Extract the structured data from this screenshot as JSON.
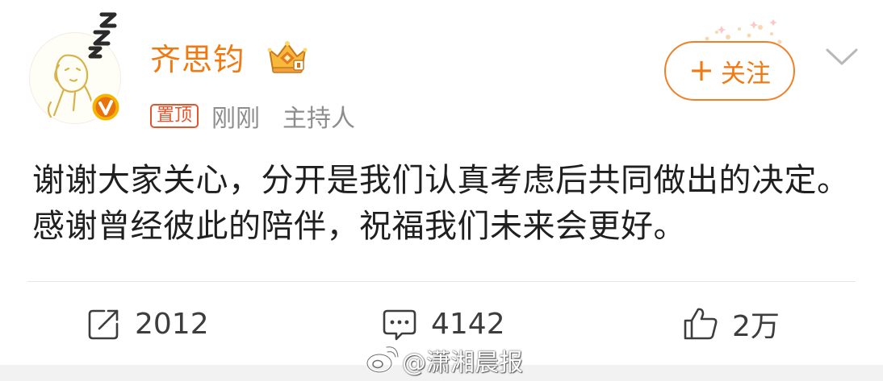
{
  "user": {
    "name": "齐思钧",
    "pin_label": "置顶",
    "time": "刚刚",
    "role": "主持人",
    "follow_label": "关注",
    "follow_plus": "+"
  },
  "post": {
    "text": "谢谢大家关心，分开是我们认真考虑后共同做出的决定。感谢曾经彼此的陪伴，祝福我们未来会更好。"
  },
  "actions": {
    "repost_count": "2012",
    "comment_count": "4142",
    "like_count": "2万"
  },
  "watermark": {
    "text": "@潇湘晨报"
  },
  "colors": {
    "accent": "#f07a11",
    "pin": "#e0552b",
    "meta": "#8d8d8d",
    "text": "#1f1f1f"
  },
  "icons": [
    "crown-icon",
    "verified-icon",
    "chevron-down-icon",
    "repost-icon",
    "comment-icon",
    "like-icon",
    "weibo-logo-icon"
  ]
}
